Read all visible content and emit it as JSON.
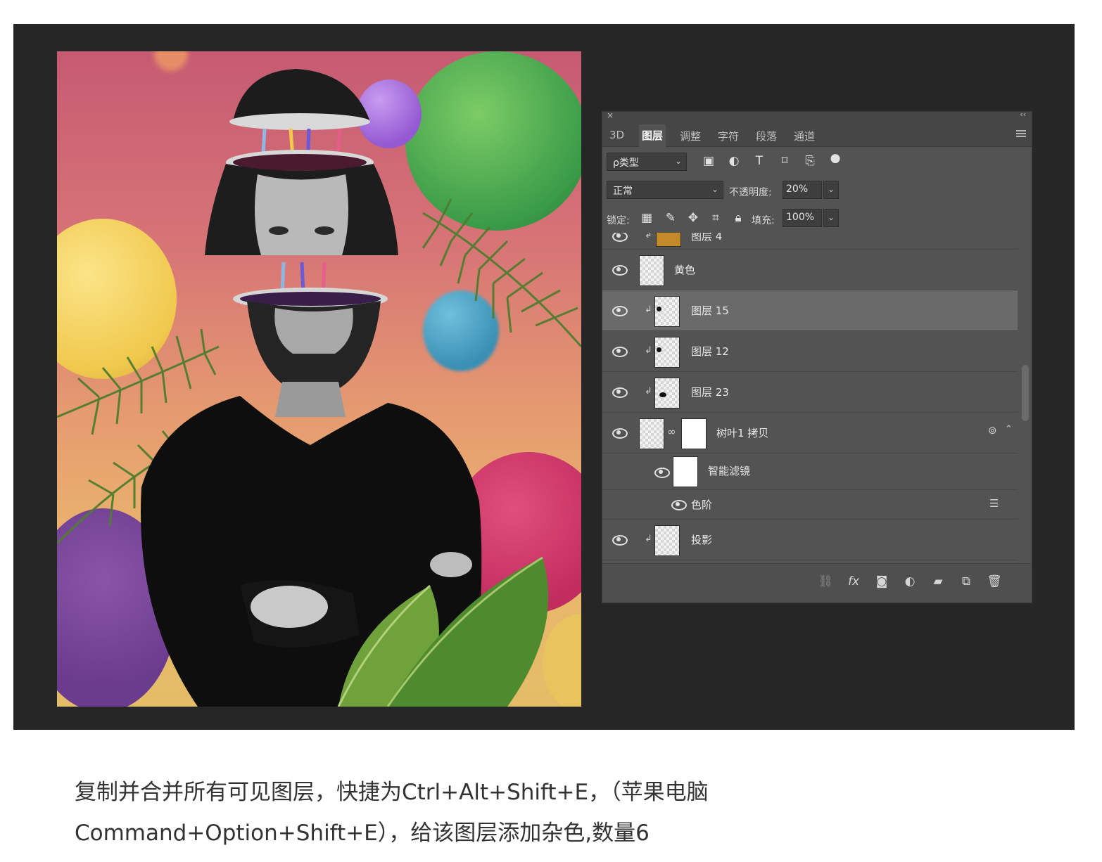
{
  "panel": {
    "tabs": [
      "3D",
      "图层",
      "调整",
      "字符",
      "段落",
      "通道"
    ],
    "filter_label": "ρ类型",
    "blend_mode": "正常",
    "opacity_label": "不透明度:",
    "opacity_value": "20%",
    "lock_label": "锁定:",
    "fill_label": "填充:",
    "fill_value": "100%",
    "layers": [
      {
        "name": "图层 4",
        "visible": true,
        "clipped": true
      },
      {
        "name": "黄色",
        "visible": true,
        "clipped": false
      },
      {
        "name": "图层 15",
        "visible": true,
        "clipped": true,
        "selected": true
      },
      {
        "name": "图层 12",
        "visible": true,
        "clipped": true
      },
      {
        "name": "图层 23",
        "visible": true,
        "clipped": true
      },
      {
        "name": "树叶1 拷贝",
        "visible": true,
        "clipped": false
      },
      {
        "name": "智能滤镜",
        "visible": true
      },
      {
        "name": "色阶",
        "visible": true
      },
      {
        "name": "投影",
        "visible": true,
        "clipped": true
      }
    ]
  },
  "caption": {
    "line1": "复制并合并所有可见图层，快捷为Ctrl+Alt+Shift+E，（苹果电脑",
    "line2": "Command+Option+Shift+E），给该图层添加杂色,数量6"
  }
}
